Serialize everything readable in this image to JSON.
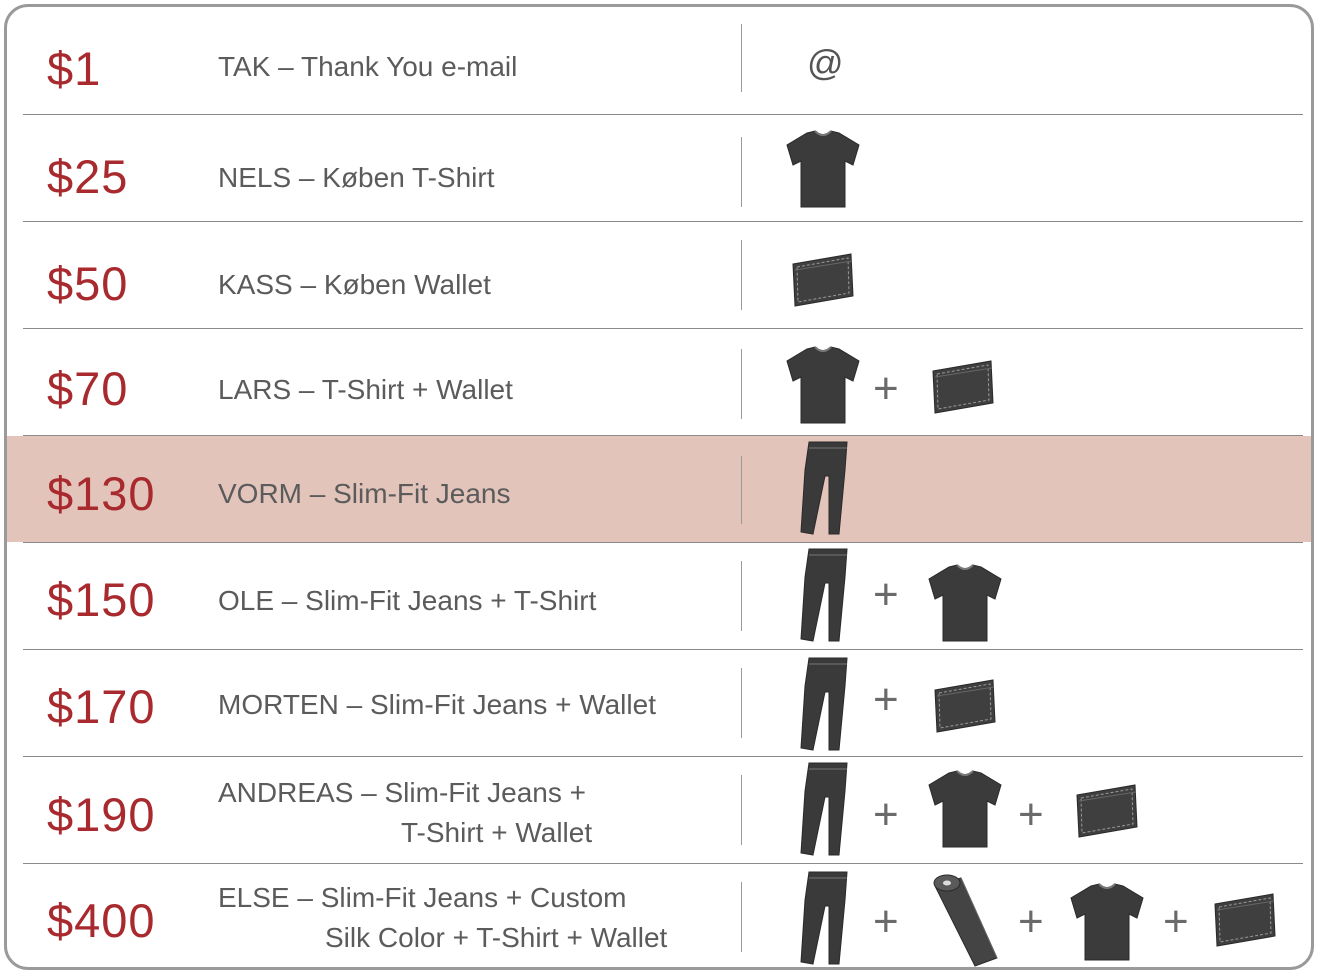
{
  "colors": {
    "price": "#a82a2e",
    "text": "#5b5b5b",
    "highlight": "#e3c4bb",
    "icon": "#3a3a3a"
  },
  "rows": [
    {
      "price": "$1",
      "name_line1": "TAK – Thank You e-mail",
      "name_line2": "",
      "highlighted": false,
      "items": [
        "at-icon"
      ]
    },
    {
      "price": "$25",
      "name_line1": "NELS – Køben T-Shirt",
      "name_line2": "",
      "highlighted": false,
      "items": [
        "tshirt-icon"
      ]
    },
    {
      "price": "$50",
      "name_line1": "KASS – Køben Wallet",
      "name_line2": "",
      "highlighted": false,
      "items": [
        "wallet-icon"
      ]
    },
    {
      "price": "$70",
      "name_line1": "LARS – T-Shirt + Wallet",
      "name_line2": "",
      "highlighted": false,
      "items": [
        "tshirt-icon",
        "wallet-icon"
      ]
    },
    {
      "price": "$130",
      "name_line1": "VORM – Slim-Fit Jeans",
      "name_line2": "",
      "highlighted": true,
      "items": [
        "jeans-icon"
      ]
    },
    {
      "price": "$150",
      "name_line1": "OLE – Slim-Fit Jeans + T-Shirt",
      "name_line2": "",
      "highlighted": false,
      "items": [
        "jeans-icon",
        "tshirt-icon"
      ]
    },
    {
      "price": "$170",
      "name_line1": "MORTEN – Slim-Fit Jeans + Wallet",
      "name_line2": "",
      "highlighted": false,
      "items": [
        "jeans-icon",
        "wallet-icon"
      ]
    },
    {
      "price": "$190",
      "name_line1": "ANDREAS – Slim-Fit Jeans +",
      "name_line2": "T-Shirt + Wallet",
      "highlighted": false,
      "items": [
        "jeans-icon",
        "tshirt-icon",
        "wallet-icon"
      ]
    },
    {
      "price": "$400",
      "name_line1": "ELSE – Slim-Fit Jeans + Custom",
      "name_line2": "Silk Color + T-Shirt + Wallet",
      "highlighted": false,
      "items": [
        "jeans-icon",
        "silk-roll-icon",
        "tshirt-icon",
        "wallet-icon"
      ]
    }
  ],
  "symbols": {
    "plus": "+",
    "at": "@"
  }
}
